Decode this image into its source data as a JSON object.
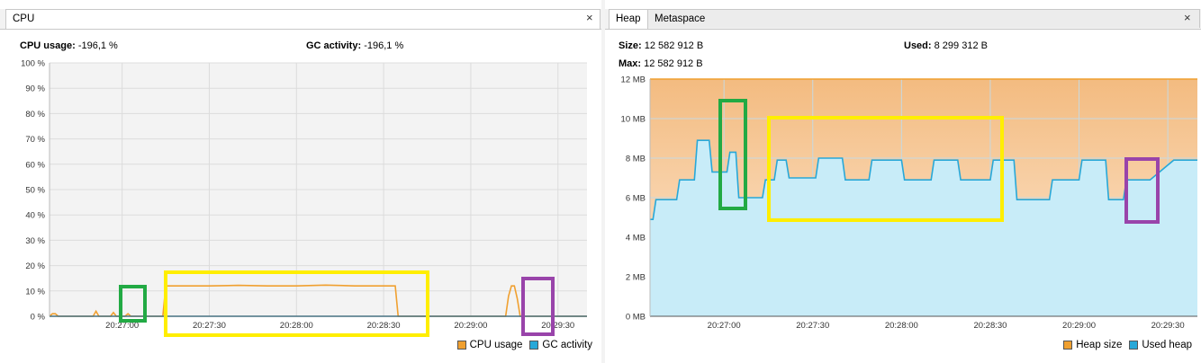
{
  "cpu": {
    "tab_label": "CPU",
    "close_glyph": "×",
    "usage_label": "CPU usage:",
    "usage_value": "-196,1 %",
    "gc_label": "GC activity:",
    "gc_value": "-196,1 %",
    "legend": [
      {
        "label": "CPU usage",
        "color": "#f0a030"
      },
      {
        "label": "GC activity",
        "color": "#28a8d8"
      }
    ]
  },
  "heap": {
    "tabs": [
      {
        "label": "Heap",
        "active": true
      },
      {
        "label": "Metaspace",
        "active": false
      }
    ],
    "close_glyph": "×",
    "size_label": "Size:",
    "size_value": "12 582 912 B",
    "max_label": "Max:",
    "max_value": "12 582 912 B",
    "used_label": "Used:",
    "used_value": "8 299 312 B",
    "legend": [
      {
        "label": "Heap size",
        "color": "#f0a030"
      },
      {
        "label": "Used heap",
        "color": "#28a8d8"
      }
    ]
  },
  "highlight_colors": {
    "green": "#22aa44",
    "yellow": "#ffee00",
    "purple": "#9944aa"
  },
  "chart_data": [
    {
      "type": "line",
      "title": "",
      "ylabel": "",
      "xlabel": "",
      "ylim": [
        0,
        100
      ],
      "y_ticks": [
        "0 %",
        "10 %",
        "20 %",
        "30 %",
        "40 %",
        "50 %",
        "60 %",
        "70 %",
        "80 %",
        "90 %",
        "100 %"
      ],
      "x_ticks": [
        "20:27:00",
        "20:27:30",
        "20:28:00",
        "20:28:30",
        "20:29:00",
        "20:29:30"
      ],
      "x_tick_seconds": [
        120,
        150,
        180,
        210,
        240,
        270
      ],
      "x_range_seconds": [
        95,
        280
      ],
      "grid": true,
      "legend_position": "bottom-right",
      "series": [
        {
          "name": "CPU usage",
          "color": "#f0a030",
          "points": [
            [
              95,
              0
            ],
            [
              96,
              1
            ],
            [
              97,
              1
            ],
            [
              98,
              0
            ],
            [
              110,
              0
            ],
            [
              111,
              2
            ],
            [
              112,
              0
            ],
            [
              116,
              0
            ],
            [
              117,
              1.5
            ],
            [
              118,
              0
            ],
            [
              121,
              0
            ],
            [
              122,
              1
            ],
            [
              123,
              0
            ],
            [
              134,
              0
            ],
            [
              135,
              12
            ],
            [
              140,
              12
            ],
            [
              150,
              12
            ],
            [
              160,
              12.2
            ],
            [
              170,
              12
            ],
            [
              180,
              12
            ],
            [
              190,
              12.3
            ],
            [
              200,
              12
            ],
            [
              210,
              12
            ],
            [
              214,
              12
            ],
            [
              215,
              0
            ],
            [
              252,
              0
            ],
            [
              253,
              8
            ],
            [
              254,
              12
            ],
            [
              255,
              12
            ],
            [
              256,
              7
            ],
            [
              257,
              0
            ],
            [
              280,
              0
            ]
          ]
        },
        {
          "name": "GC activity",
          "color": "#28a8d8",
          "points": [
            [
              95,
              0
            ],
            [
              280,
              0
            ]
          ]
        }
      ]
    },
    {
      "type": "area",
      "title": "",
      "ylabel": "",
      "xlabel": "",
      "ylim": [
        0,
        12
      ],
      "y_ticks": [
        "0 MB",
        "2 MB",
        "4 MB",
        "6 MB",
        "8 MB",
        "10 MB",
        "12 MB"
      ],
      "x_ticks": [
        "20:27:00",
        "20:27:30",
        "20:28:00",
        "20:28:30",
        "20:29:00",
        "20:29:30"
      ],
      "x_tick_seconds": [
        120,
        150,
        180,
        210,
        240,
        270
      ],
      "x_range_seconds": [
        95,
        280
      ],
      "grid": true,
      "legend_position": "bottom-right",
      "series": [
        {
          "name": "Heap size",
          "color": "#f0a030",
          "points": [
            [
              95,
              12
            ],
            [
              280,
              12
            ]
          ]
        },
        {
          "name": "Used heap",
          "color": "#28a8d8",
          "points": [
            [
              95,
              4.9
            ],
            [
              96,
              4.9
            ],
            [
              97,
              5.9
            ],
            [
              104,
              5.9
            ],
            [
              105,
              6.9
            ],
            [
              110,
              6.9
            ],
            [
              111,
              8.9
            ],
            [
              115,
              8.9
            ],
            [
              116,
              7.3
            ],
            [
              121,
              7.3
            ],
            [
              122,
              8.3
            ],
            [
              124,
              8.3
            ],
            [
              125,
              6.0
            ],
            [
              133,
              6.0
            ],
            [
              134,
              6.9
            ],
            [
              137,
              6.9
            ],
            [
              138,
              7.9
            ],
            [
              141,
              7.9
            ],
            [
              142,
              7.0
            ],
            [
              151,
              7.0
            ],
            [
              152,
              8.0
            ],
            [
              160,
              8.0
            ],
            [
              161,
              6.9
            ],
            [
              169,
              6.9
            ],
            [
              170,
              7.9
            ],
            [
              180,
              7.9
            ],
            [
              181,
              6.9
            ],
            [
              190,
              6.9
            ],
            [
              191,
              7.9
            ],
            [
              199,
              7.9
            ],
            [
              200,
              6.9
            ],
            [
              210,
              6.9
            ],
            [
              211,
              7.9
            ],
            [
              218,
              7.9
            ],
            [
              219,
              5.9
            ],
            [
              230,
              5.9
            ],
            [
              231,
              6.9
            ],
            [
              240,
              6.9
            ],
            [
              241,
              7.9
            ],
            [
              249,
              7.9
            ],
            [
              250,
              5.9
            ],
            [
              255,
              5.9
            ],
            [
              256,
              6.9
            ],
            [
              264,
              6.9
            ],
            [
              272,
              7.9
            ],
            [
              280,
              7.9
            ]
          ]
        }
      ]
    }
  ]
}
